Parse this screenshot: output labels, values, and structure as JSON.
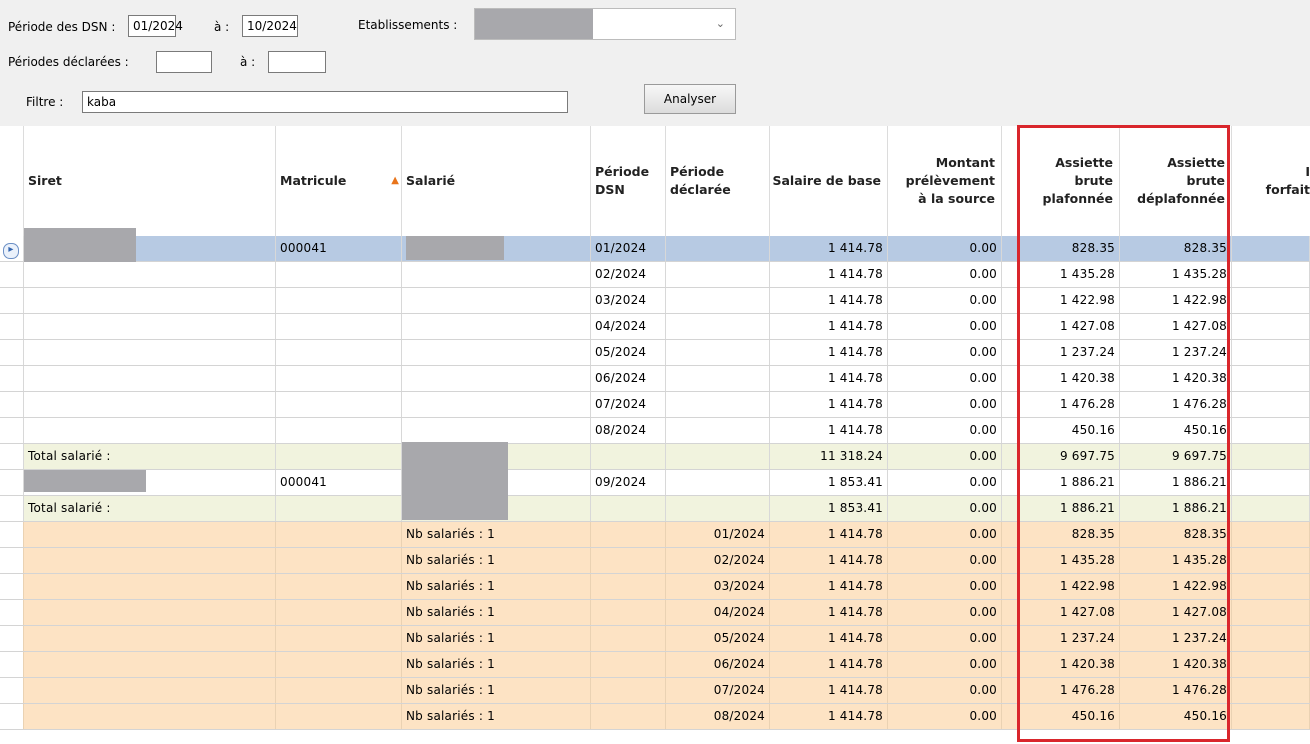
{
  "filters": {
    "periode_dsn_label": "Période des DSN :",
    "periode_dsn_from": "01/2024",
    "a_label": "à :",
    "periode_dsn_to": "10/2024",
    "etablissements_label": "Etablissements :",
    "periodes_declarees_label": "Périodes déclarées :",
    "periodes_declarees_from": "",
    "periodes_declarees_to": "",
    "filtre_label": "Filtre :",
    "filtre_value": "kaba",
    "analyser_label": "Analyser"
  },
  "columns": {
    "siret": "Siret",
    "matricule": "Matricule",
    "salarie": "Salarié",
    "periode_dsn": [
      "Période",
      "DSN"
    ],
    "periode_declaree": [
      "Période",
      "déclarée"
    ],
    "salaire_base": "Salaire de base",
    "montant": [
      "Montant",
      "prélèvement",
      "à la source"
    ],
    "assiette_plaf": [
      "Assiette",
      "brute",
      "plafonnée"
    ],
    "assiette_deplaf": [
      "Assiette",
      "brute",
      "déplafonnée"
    ],
    "next_col": [
      "I",
      "forfait"
    ]
  },
  "rows": [
    {
      "type": "sel",
      "matricule": "000041",
      "periode_dsn": "01/2024",
      "periode_dec": "",
      "salaire": "1 414.78",
      "montant": "0.00",
      "plaf": "828.35",
      "deplaf": "828.35"
    },
    {
      "type": "data",
      "matricule": "",
      "periode_dsn": "02/2024",
      "periode_dec": "",
      "salaire": "1 414.78",
      "montant": "0.00",
      "plaf": "1 435.28",
      "deplaf": "1 435.28"
    },
    {
      "type": "data",
      "matricule": "",
      "periode_dsn": "03/2024",
      "periode_dec": "",
      "salaire": "1 414.78",
      "montant": "0.00",
      "plaf": "1 422.98",
      "deplaf": "1 422.98"
    },
    {
      "type": "data",
      "matricule": "",
      "periode_dsn": "04/2024",
      "periode_dec": "",
      "salaire": "1 414.78",
      "montant": "0.00",
      "plaf": "1 427.08",
      "deplaf": "1 427.08"
    },
    {
      "type": "data",
      "matricule": "",
      "periode_dsn": "05/2024",
      "periode_dec": "",
      "salaire": "1 414.78",
      "montant": "0.00",
      "plaf": "1 237.24",
      "deplaf": "1 237.24"
    },
    {
      "type": "data",
      "matricule": "",
      "periode_dsn": "06/2024",
      "periode_dec": "",
      "salaire": "1 414.78",
      "montant": "0.00",
      "plaf": "1 420.38",
      "deplaf": "1 420.38"
    },
    {
      "type": "data",
      "matricule": "",
      "periode_dsn": "07/2024",
      "periode_dec": "",
      "salaire": "1 414.78",
      "montant": "0.00",
      "plaf": "1 476.28",
      "deplaf": "1 476.28"
    },
    {
      "type": "data",
      "matricule": "",
      "periode_dsn": "08/2024",
      "periode_dec": "",
      "salaire": "1 414.78",
      "montant": "0.00",
      "plaf": "450.16",
      "deplaf": "450.16"
    },
    {
      "type": "tot",
      "siret": "Total salarié :",
      "salaire": "11 318.24",
      "montant": "0.00",
      "plaf": "9 697.75",
      "deplaf": "9 697.75"
    },
    {
      "type": "data",
      "matricule": "000041",
      "periode_dsn": "09/2024",
      "periode_dec": "",
      "salaire": "1 853.41",
      "montant": "0.00",
      "plaf": "1 886.21",
      "deplaf": "1 886.21"
    },
    {
      "type": "tot",
      "siret": "Total salarié :",
      "salaire": "1 853.41",
      "montant": "0.00",
      "plaf": "1 886.21",
      "deplaf": "1 886.21"
    },
    {
      "type": "grp",
      "salarie": "Nb salariés : 1",
      "periode_dec": "01/2024",
      "salaire": "1 414.78",
      "montant": "0.00",
      "plaf": "828.35",
      "deplaf": "828.35"
    },
    {
      "type": "grp",
      "salarie": "Nb salariés : 1",
      "periode_dec": "02/2024",
      "salaire": "1 414.78",
      "montant": "0.00",
      "plaf": "1 435.28",
      "deplaf": "1 435.28"
    },
    {
      "type": "grp",
      "salarie": "Nb salariés : 1",
      "periode_dec": "03/2024",
      "salaire": "1 414.78",
      "montant": "0.00",
      "plaf": "1 422.98",
      "deplaf": "1 422.98"
    },
    {
      "type": "grp",
      "salarie": "Nb salariés : 1",
      "periode_dec": "04/2024",
      "salaire": "1 414.78",
      "montant": "0.00",
      "plaf": "1 427.08",
      "deplaf": "1 427.08"
    },
    {
      "type": "grp",
      "salarie": "Nb salariés : 1",
      "periode_dec": "05/2024",
      "salaire": "1 414.78",
      "montant": "0.00",
      "plaf": "1 237.24",
      "deplaf": "1 237.24"
    },
    {
      "type": "grp",
      "salarie": "Nb salariés : 1",
      "periode_dec": "06/2024",
      "salaire": "1 414.78",
      "montant": "0.00",
      "plaf": "1 420.38",
      "deplaf": "1 420.38"
    },
    {
      "type": "grp",
      "salarie": "Nb salariés : 1",
      "periode_dec": "07/2024",
      "salaire": "1 414.78",
      "montant": "0.00",
      "plaf": "1 476.28",
      "deplaf": "1 476.28"
    },
    {
      "type": "grp",
      "salarie": "Nb salariés : 1",
      "periode_dec": "08/2024",
      "salaire": "1 414.78",
      "montant": "0.00",
      "plaf": "450.16",
      "deplaf": "450.16"
    }
  ],
  "colors": {
    "selected_row": "#b7cae3",
    "total_row": "#f1f3de",
    "group_row": "#fde3c4",
    "highlight_box": "#d9262c",
    "sort_arrow": "#e8741a"
  }
}
